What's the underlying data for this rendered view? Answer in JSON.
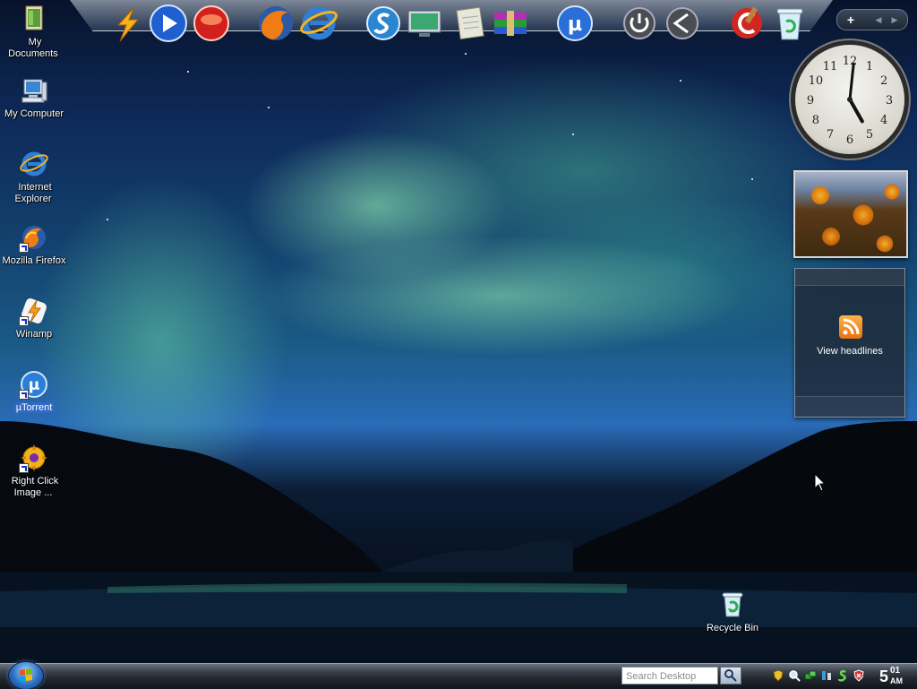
{
  "desktop": {
    "icons": [
      {
        "label": "My Documents",
        "icon": "folder-documents-icon",
        "shortcut": false,
        "selected": false
      },
      {
        "label": "My Computer",
        "icon": "computer-icon",
        "shortcut": false,
        "selected": false
      },
      {
        "label": "Internet Explorer",
        "icon": "internet-explorer-icon",
        "shortcut": false,
        "selected": false
      },
      {
        "label": "Mozilla Firefox",
        "icon": "firefox-icon",
        "shortcut": true,
        "selected": false
      },
      {
        "label": "Winamp",
        "icon": "winamp-icon",
        "shortcut": true,
        "selected": false
      },
      {
        "label": "µTorrent",
        "icon": "utorrent-icon",
        "shortcut": true,
        "selected": true
      },
      {
        "label": "Right Click Image ...",
        "icon": "right-click-image-resizer-icon",
        "shortcut": true,
        "selected": false
      },
      {
        "label": "Recycle Bin",
        "icon": "recycle-bin-icon",
        "shortcut": false,
        "selected": false
      }
    ]
  },
  "dock": {
    "items": [
      {
        "icon": "winamp-lightning-icon"
      },
      {
        "icon": "media-player-play-icon"
      },
      {
        "icon": "media-center-icon"
      },
      {
        "icon": "firefox-icon"
      },
      {
        "icon": "internet-explorer-icon"
      },
      {
        "icon": "skype-icon"
      },
      {
        "icon": "display-monitor-icon"
      },
      {
        "icon": "notepad-icon"
      },
      {
        "icon": "winrar-books-icon"
      },
      {
        "icon": "utorrent-icon"
      },
      {
        "icon": "power-icon"
      },
      {
        "icon": "back-arrow-icon"
      },
      {
        "icon": "ccleaner-icon"
      },
      {
        "icon": "recycle-bin-icon"
      }
    ]
  },
  "sidebar": {
    "toolbar": {
      "add_label": "+",
      "prev_label": "◀",
      "next_label": "▶"
    },
    "clock": {
      "hour": 5,
      "minute": 1,
      "numerals": [
        "12",
        "1",
        "2",
        "3",
        "4",
        "5",
        "6",
        "7",
        "8",
        "9",
        "10",
        "11"
      ]
    },
    "feed": {
      "label": "View headlines",
      "icon": "rss-feed-icon"
    }
  },
  "taskbar": {
    "start_icon": "windows-orb-icon",
    "search_placeholder": "Search Desktop",
    "tray_icons": [
      "security-shield-icon",
      "search-magnifier-icon",
      "network-icon",
      "volume-icon",
      "skype-status-icon",
      "security-center-icon"
    ],
    "clock": {
      "hour": "5",
      "minute": "01",
      "ampm": "AM"
    }
  },
  "colors": {
    "selection": "#316ac5",
    "feed_orange": "#f08a1c",
    "aurora_green": "#8ff0b4"
  }
}
